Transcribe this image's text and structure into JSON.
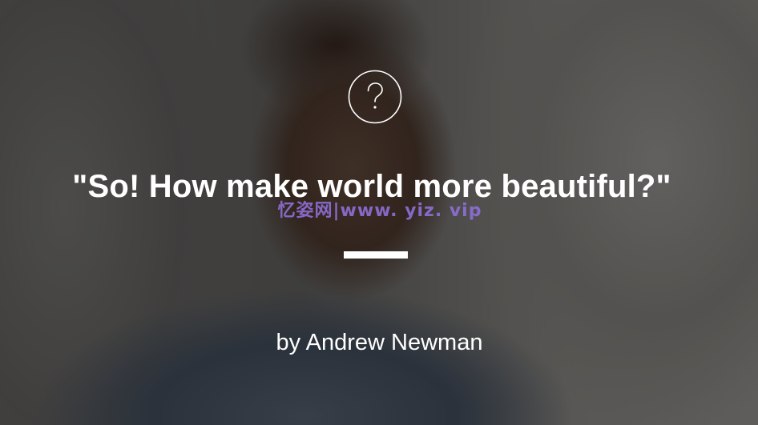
{
  "hero": {
    "icon": "question-circle-icon",
    "quote": "\"So! How make world more beautiful?\"",
    "watermark": "忆姿网|www. yiz. vip",
    "byline": "by Andrew Newman"
  },
  "colors": {
    "text": "#ffffff",
    "overlay": "rgba(0,0,0,0.55)",
    "watermark": "#8f6fd8",
    "divider": "#ffffff"
  }
}
